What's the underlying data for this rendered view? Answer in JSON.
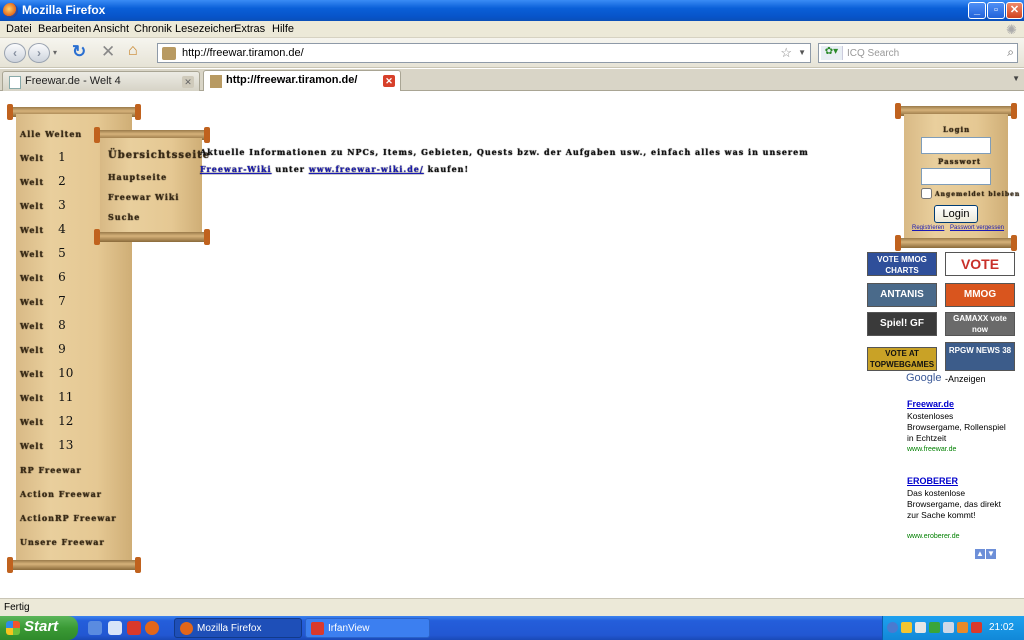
{
  "window": {
    "title": "Mozilla Firefox"
  },
  "menu": [
    "Datei",
    "Bearbeiten",
    "Ansicht",
    "Chronik",
    "Lesezeichen",
    "Extras",
    "Hilfe"
  ],
  "navbar": {
    "url": "http://freewar.tiramon.de/",
    "search_placeholder": "ICQ Search"
  },
  "tabs": [
    {
      "label": "Freewar.de - Welt 4",
      "active": false
    },
    {
      "label": "http://freewar.tiramon.de/",
      "active": true
    }
  ],
  "page": {
    "left_nav": {
      "header": "Alle Welten",
      "worlds": [
        {
          "prefix": "Welt",
          "number": "1"
        },
        {
          "prefix": "Welt",
          "number": "2"
        },
        {
          "prefix": "Welt",
          "number": "3"
        },
        {
          "prefix": "Welt",
          "number": "4"
        },
        {
          "prefix": "Welt",
          "number": "5"
        },
        {
          "prefix": "Welt",
          "number": "6"
        },
        {
          "prefix": "Welt",
          "number": "7"
        },
        {
          "prefix": "Welt",
          "number": "8"
        },
        {
          "prefix": "Welt",
          "number": "9"
        },
        {
          "prefix": "Welt",
          "number": "10"
        },
        {
          "prefix": "Welt",
          "number": "11"
        },
        {
          "prefix": "Welt",
          "number": "12"
        },
        {
          "prefix": "Welt",
          "number": "13"
        }
      ],
      "extra": [
        "RP Freewar",
        "Action Freewar",
        "ActionRP Freewar",
        "Unsere Freewar"
      ]
    },
    "submenu": [
      "Übersichtsseite",
      "Hauptseite",
      "Freewar Wiki",
      "Suche"
    ],
    "intro": {
      "text_before": "Aktuelle Informationen zu NPCs, Items, Gebieten, Quests bzw. der Aufgaben usw., einfach alles was in unserem",
      "link1": "Freewar-Wiki",
      "text_mid": "unter",
      "link2": "www.freewar-wiki.de/",
      "text_after": "kaufen!"
    },
    "login": {
      "user_label": "Login",
      "pass_label": "Passwort",
      "remember_label": "Angemeldet bleiben",
      "button": "Login",
      "link1": "Registrieren",
      "link2": "Passwort vergessen"
    },
    "banners": [
      {
        "text": "VOTE MMOG CHARTS",
        "color": "#2f4f9a"
      },
      {
        "text": "VOTE",
        "color": "#c8302a"
      },
      {
        "text": "ANTANIS",
        "color": "#4a6a8a"
      },
      {
        "text": "MMOG CHARTS",
        "color": "#d9551e"
      },
      {
        "text": "Spiel! GF",
        "color": "#3a3a3a"
      },
      {
        "text": "GAMAXX vote now",
        "color": "#6a6a6a"
      },
      {
        "text": "VOTE AT TOPWEBGAMES",
        "color": "#c9a226"
      },
      {
        "text": "RPGW NEWS 38",
        "color": "#3c5c8a"
      }
    ],
    "ads": {
      "google_label": "Google",
      "ads_label": "-Anzeigen",
      "items": [
        {
          "title": "Freewar.de",
          "text": "Kostenloses Browsergame, Rollenspiel in Echtzeit",
          "url": "www.freewar.de"
        },
        {
          "title": "EROBERER",
          "text": "Das kostenlose Browsergame, das direkt zur Sache kommt!",
          "url": "www.eroberer.de"
        }
      ]
    }
  },
  "status": "Fertig",
  "taskbar": {
    "start": "Start",
    "tasks": [
      "Mozilla Firefox",
      "IrfanView"
    ],
    "clock": "21:02"
  }
}
